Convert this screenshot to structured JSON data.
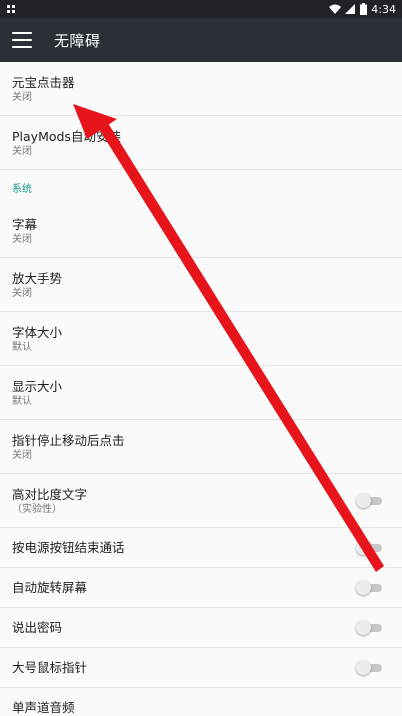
{
  "status_bar": {
    "time": "4:34",
    "left_icon": "notification-icon",
    "wifi_icon": "wifi-icon",
    "signal_icon": "signal-icon",
    "battery_icon": "battery-icon"
  },
  "toolbar": {
    "title": "无障碍",
    "menu_icon": "menu-icon"
  },
  "items_top": [
    {
      "title": "元宝点击器",
      "subtitle": "关闭"
    },
    {
      "title": "PlayMods自动安装",
      "subtitle": "关闭"
    }
  ],
  "section": "系统",
  "items_system": [
    {
      "title": "字幕",
      "subtitle": "关闭"
    },
    {
      "title": "放大手势",
      "subtitle": "关闭"
    },
    {
      "title": "字体大小",
      "subtitle": "默认"
    },
    {
      "title": "显示大小",
      "subtitle": "默认"
    },
    {
      "title": "指针停止移动后点击",
      "subtitle": "关闭"
    },
    {
      "title": "高对比度文字",
      "subtitle": "（实验性）",
      "toggle": false
    }
  ],
  "items_toggles": [
    {
      "title": "按电源按钮结束通话",
      "toggle": false
    },
    {
      "title": "自动旋转屏幕",
      "toggle": false
    },
    {
      "title": "说出密码",
      "toggle": false
    },
    {
      "title": "大号鼠标指针",
      "toggle": false
    },
    {
      "title": "单声道音频"
    }
  ],
  "annotation": {
    "color": "#e8141b"
  }
}
